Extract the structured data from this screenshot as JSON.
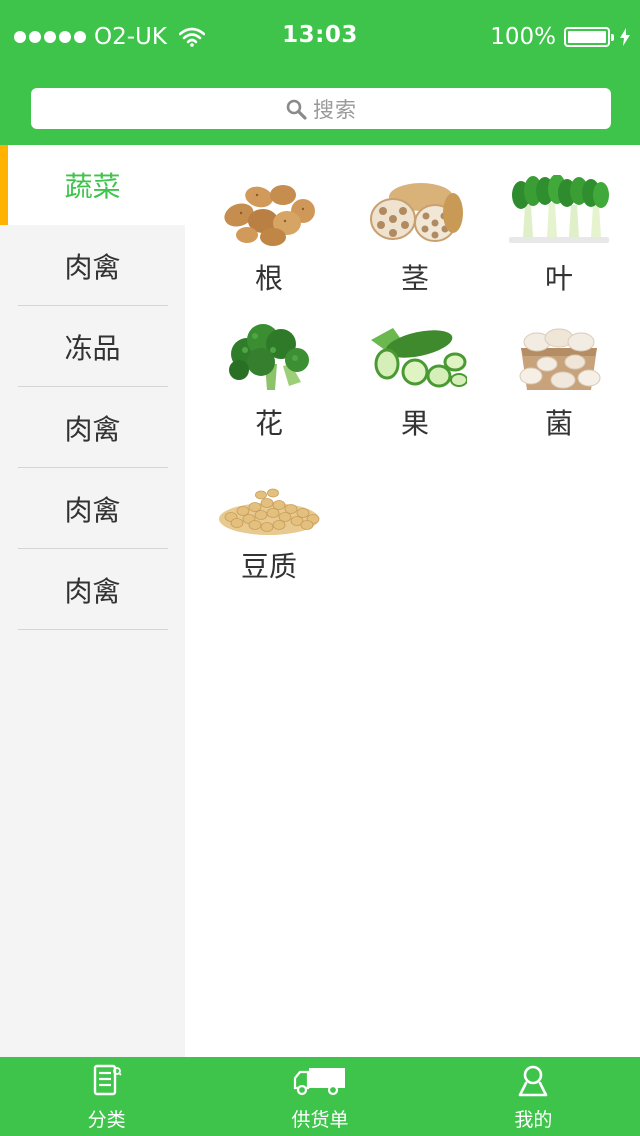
{
  "status": {
    "carrier": "O2-UK",
    "time": "13:03",
    "battery": "100%",
    "battery_level": 1.0,
    "signal_dots": 5
  },
  "search": {
    "placeholder": "搜索",
    "icon": "search-icon"
  },
  "colors": {
    "brand_green": "#3fc44b",
    "active_marker": "#ffb300",
    "sidebar_bg": "#f4f4f4"
  },
  "sidebar": {
    "items": [
      {
        "label": "蔬菜",
        "active": true
      },
      {
        "label": "肉禽"
      },
      {
        "label": "冻品"
      },
      {
        "label": "肉禽"
      },
      {
        "label": "肉禽"
      },
      {
        "label": "肉禽"
      }
    ]
  },
  "grid": {
    "items": [
      {
        "label": "根",
        "image": "potatoes"
      },
      {
        "label": "茎",
        "image": "lotus-root"
      },
      {
        "label": "叶",
        "image": "bok-choy"
      },
      {
        "label": "花",
        "image": "broccoli"
      },
      {
        "label": "果",
        "image": "cucumber"
      },
      {
        "label": "菌",
        "image": "mushrooms"
      },
      {
        "label": "豆质",
        "image": "soybeans"
      }
    ]
  },
  "tabbar": {
    "tabs": [
      {
        "label": "分类",
        "icon": "category-list-icon"
      },
      {
        "label": "供货单",
        "icon": "delivery-truck-icon"
      },
      {
        "label": "我的",
        "icon": "user-profile-icon"
      }
    ]
  }
}
